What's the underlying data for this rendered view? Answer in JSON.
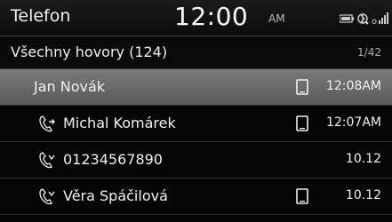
{
  "status_bar": {
    "app_title": "Telefon",
    "clock": "12:00",
    "ampm": "AM",
    "icons": [
      "battery-icon",
      "bluetooth-phone-icon",
      "signal-icon"
    ]
  },
  "header": {
    "title": "Všechny hovory (124)",
    "page_counter": "1/42"
  },
  "calls": [
    {
      "name": "Jan Novák",
      "time": "12:08AM",
      "type": "none",
      "device_icon": "phone-icon",
      "selected": true
    },
    {
      "name": "Michal Komárek",
      "time": "12:07AM",
      "type": "outgoing-call-icon",
      "device_icon": "phone-icon",
      "selected": false
    },
    {
      "name": "01234567890",
      "time": "10.12",
      "type": "missed-call-icon",
      "device_icon": "",
      "selected": false
    },
    {
      "name": "Věra Spáčilová",
      "time": "10.12",
      "type": "missed-call-icon",
      "device_icon": "phone-icon",
      "selected": false
    }
  ],
  "colors": {
    "background": "#050505",
    "selected_row": "#6b6b6b",
    "text": "#f2f2f2"
  }
}
